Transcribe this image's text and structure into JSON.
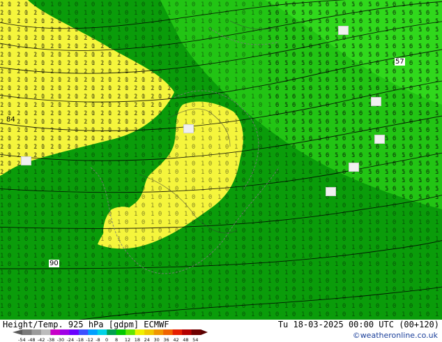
{
  "title_left": "Height/Temp. 925 hPa [gdpm] ECMWF",
  "title_right": "Tu 18-03-2025 00:00 UTC (00+120)",
  "credit": "©weatheronline.co.uk",
  "contour_labels": [
    "57",
    "84",
    "90"
  ],
  "colorbar": {
    "ticks": [
      "-54",
      "-48",
      "-42",
      "-38",
      "-30",
      "-24",
      "-18",
      "-12",
      "-8",
      "0",
      "8",
      "12",
      "18",
      "24",
      "30",
      "36",
      "42",
      "48",
      "54"
    ],
    "colors": [
      "#7a7a7a",
      "#9b9b9b",
      "#bcbcbc",
      "#c800c8",
      "#a000e6",
      "#6a00ff",
      "#3c50ff",
      "#00a0ff",
      "#00d2e6",
      "#00a050",
      "#00c800",
      "#64e600",
      "#f0f000",
      "#f0c800",
      "#f09600",
      "#f06400",
      "#e61e00",
      "#b40000",
      "#6e0000"
    ]
  },
  "map_colors": {
    "green_dark": "#0a9c0a",
    "green": "#1fbe12",
    "green_light": "#2ed51a",
    "yellow": "#f5f53c"
  }
}
